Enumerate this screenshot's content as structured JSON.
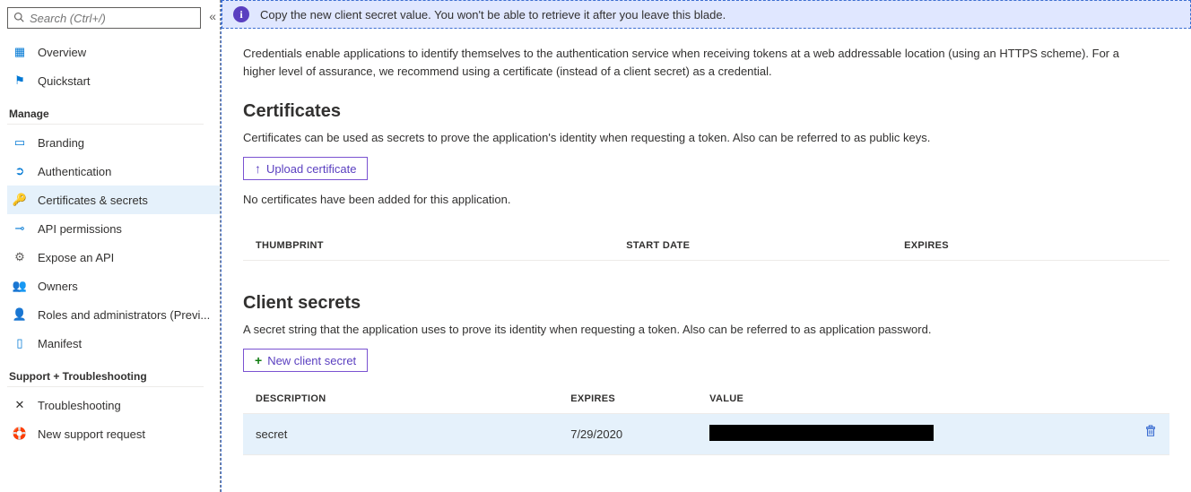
{
  "search": {
    "placeholder": "Search (Ctrl+/)"
  },
  "notice": {
    "text": "Copy the new client secret value. You won't be able to retrieve it after you leave this blade."
  },
  "intro": "Credentials enable applications to identify themselves to the authentication service when receiving tokens at a web addressable location (using an HTTPS scheme). For a higher level of assurance, we recommend using a certificate (instead of a client secret) as a credential.",
  "nav": {
    "items_top": [
      {
        "label": "Overview"
      },
      {
        "label": "Quickstart"
      }
    ],
    "group_manage": "Manage",
    "items_manage": [
      {
        "label": "Branding"
      },
      {
        "label": "Authentication"
      },
      {
        "label": "Certificates & secrets"
      },
      {
        "label": "API permissions"
      },
      {
        "label": "Expose an API"
      },
      {
        "label": "Owners"
      },
      {
        "label": "Roles and administrators (Previ..."
      },
      {
        "label": "Manifest"
      }
    ],
    "group_support": "Support + Troubleshooting",
    "items_support": [
      {
        "label": "Troubleshooting"
      },
      {
        "label": "New support request"
      }
    ]
  },
  "certs": {
    "heading": "Certificates",
    "subtext": "Certificates can be used as secrets to prove the application's identity when requesting a token. Also can be referred to as public keys.",
    "upload_btn": "Upload certificate",
    "empty": "No certificates have been added for this application.",
    "cols": {
      "thumbprint": "THUMBPRINT",
      "start": "START DATE",
      "expires": "EXPIRES"
    }
  },
  "secrets": {
    "heading": "Client secrets",
    "subtext": "A secret string that the application uses to prove its identity when requesting a token. Also can be referred to as application password.",
    "new_btn": "New client secret",
    "cols": {
      "description": "DESCRIPTION",
      "expires": "EXPIRES",
      "value": "VALUE"
    },
    "rows": [
      {
        "description": "secret",
        "expires": "7/29/2020",
        "value": ""
      }
    ]
  }
}
